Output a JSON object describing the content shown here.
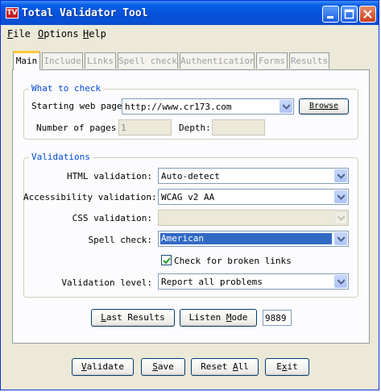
{
  "window": {
    "title": "Total Validator Tool",
    "icon_text": "TV"
  },
  "menu": [
    {
      "accel": "F",
      "rest": "ile"
    },
    {
      "accel": "O",
      "rest": "ptions"
    },
    {
      "accel": "H",
      "rest": "elp"
    }
  ],
  "tabs": [
    "Main",
    "Include",
    "Links",
    "Spell check",
    "Authentication",
    "Forms",
    "Results"
  ],
  "what_to_check": {
    "title": "What to check",
    "starting_page_label": "Starting web page:",
    "starting_page_value": "http://www.cr173.com",
    "browse_label": "Browse",
    "pages_label": "Number of pages:",
    "pages_value": "1",
    "depth_label": "Depth:",
    "depth_value": ""
  },
  "validations": {
    "title": "Validations",
    "html_label": "HTML validation:",
    "html_value": "Auto-detect",
    "access_label": "Accessibility validation:",
    "access_value": "WCAG v2 AA",
    "css_label": "CSS validation:",
    "css_value": "",
    "spell_label": "Spell check:",
    "spell_value": "American",
    "broken_links_label": "Check for broken links",
    "broken_links_checked": true,
    "level_label": "Validation level:",
    "level_value": "Report all problems"
  },
  "results_row": {
    "last_results_accel": "L",
    "last_results_rest": "ast Results",
    "listen_pre": "Listen ",
    "listen_accel": "M",
    "listen_rest": "ode",
    "port": "9889"
  },
  "footer": {
    "validate_accel": "V",
    "validate_rest": "alidate",
    "save_accel": "S",
    "save_rest": "ave",
    "reset_pre": "Reset ",
    "reset_accel": "A",
    "reset_rest": "ll",
    "exit_pre": "E",
    "exit_accel": "x",
    "exit_rest": "it"
  },
  "colors": {
    "accent": "#0046d5",
    "titlebar": "#0550d8",
    "selection": "#316ac5"
  }
}
